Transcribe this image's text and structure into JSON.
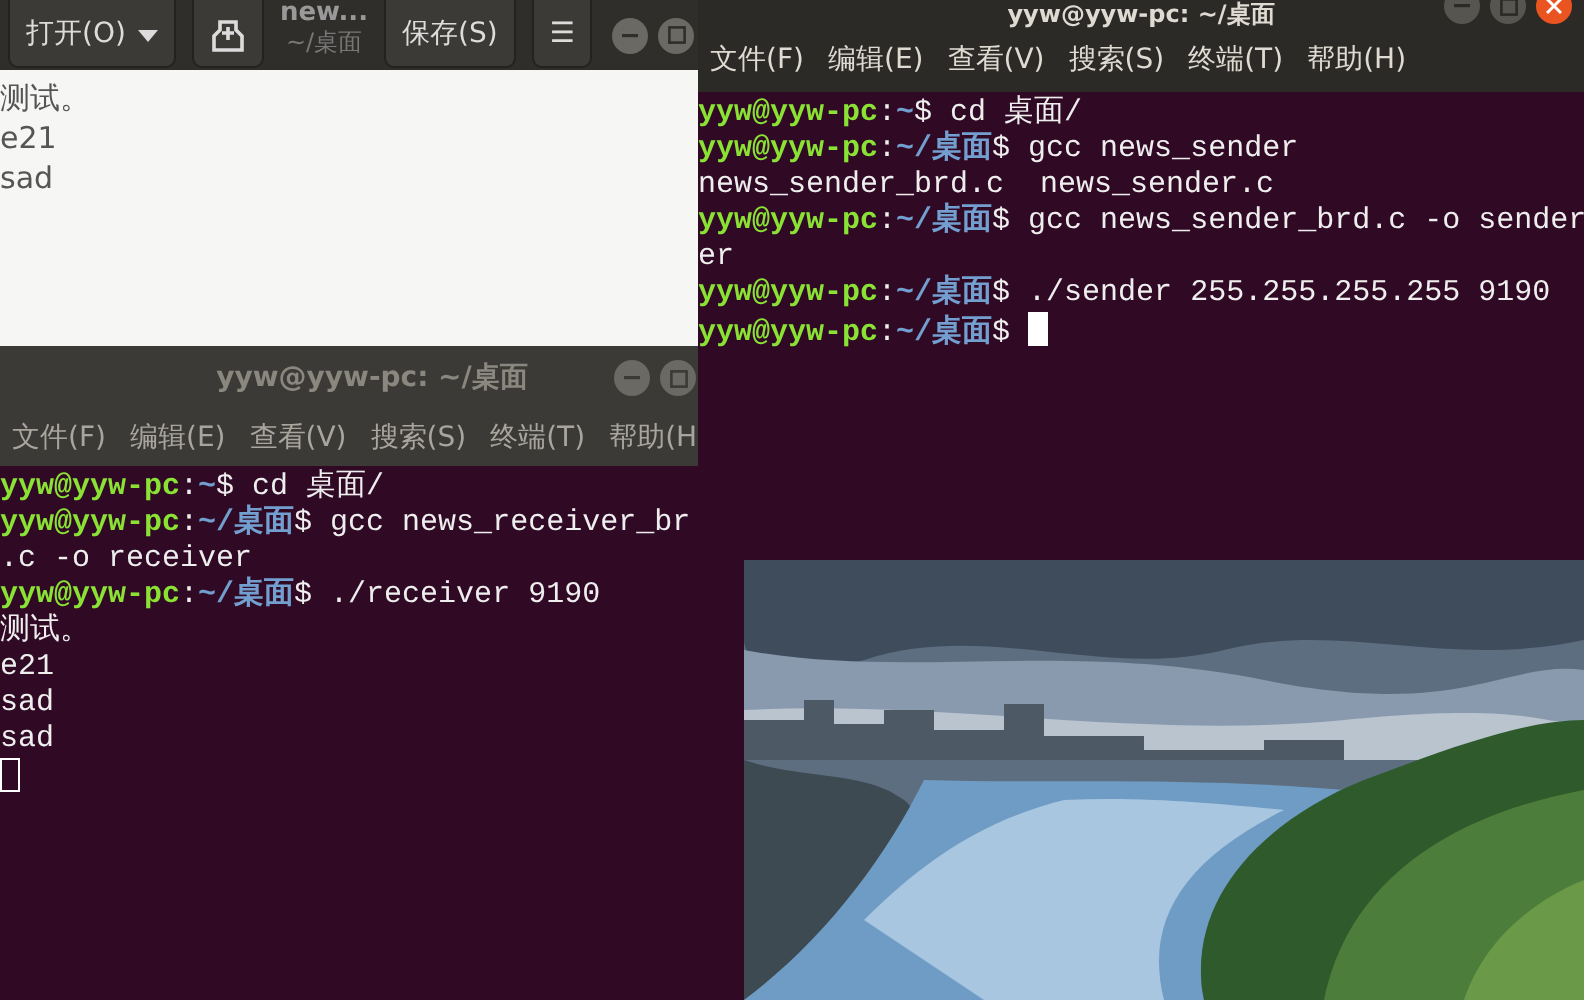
{
  "editor": {
    "open_button": "打开(O)",
    "title": "new...",
    "subtitle": "~/桌面",
    "save_button": "保存(S)",
    "menu_button": "☰",
    "lines": [
      "测试。",
      "e21",
      "sad"
    ]
  },
  "terminals": [
    {
      "title": "yyw@yyw-pc: ~/桌面",
      "focused": false,
      "menu": [
        "文件(F)",
        "编辑(E)",
        "查看(V)",
        "搜索(S)",
        "终端(T)",
        "帮助(H"
      ],
      "lines": [
        [
          {
            "kind": "user",
            "text": "yyw@yyw-pc"
          },
          {
            "kind": "plain",
            "text": ":"
          },
          {
            "kind": "path",
            "text": "~"
          },
          {
            "kind": "plain",
            "text": "$ cd 桌面/"
          }
        ],
        [
          {
            "kind": "user",
            "text": "yyw@yyw-pc"
          },
          {
            "kind": "plain",
            "text": ":"
          },
          {
            "kind": "path",
            "text": "~/桌面"
          },
          {
            "kind": "plain",
            "text": "$ gcc news_receiver_br"
          }
        ],
        [
          {
            "kind": "plain",
            "text": ".c -o receiver"
          }
        ],
        [
          {
            "kind": "user",
            "text": "yyw@yyw-pc"
          },
          {
            "kind": "plain",
            "text": ":"
          },
          {
            "kind": "path",
            "text": "~/桌面"
          },
          {
            "kind": "plain",
            "text": "$ ./receiver 9190"
          }
        ],
        [
          {
            "kind": "plain",
            "text": "测试。"
          }
        ],
        [
          {
            "kind": "plain",
            "text": "e21"
          }
        ],
        [
          {
            "kind": "plain",
            "text": "sad"
          }
        ],
        [
          {
            "kind": "plain",
            "text": "sad"
          }
        ]
      ]
    },
    {
      "title": "yyw@yyw-pc: ~/桌面",
      "focused": true,
      "menu": [
        "文件(F)",
        "编辑(E)",
        "查看(V)",
        "搜索(S)",
        "终端(T)",
        "帮助(H)"
      ],
      "lines": [
        [
          {
            "kind": "user",
            "text": "yyw@yyw-pc"
          },
          {
            "kind": "plain",
            "text": ":"
          },
          {
            "kind": "path",
            "text": "~"
          },
          {
            "kind": "plain",
            "text": "$ cd 桌面/"
          }
        ],
        [
          {
            "kind": "user",
            "text": "yyw@yyw-pc"
          },
          {
            "kind": "plain",
            "text": ":"
          },
          {
            "kind": "path",
            "text": "~/桌面"
          },
          {
            "kind": "plain",
            "text": "$ gcc news_sender"
          }
        ],
        [
          {
            "kind": "plain",
            "text": "news_sender_brd.c  news_sender.c"
          }
        ],
        [
          {
            "kind": "user",
            "text": "yyw@yyw-pc"
          },
          {
            "kind": "plain",
            "text": ":"
          },
          {
            "kind": "path",
            "text": "~/桌面"
          },
          {
            "kind": "plain",
            "text": "$ gcc news_sender_brd.c -o sender"
          }
        ],
        [
          {
            "kind": "plain",
            "text": "er"
          }
        ],
        [
          {
            "kind": "user",
            "text": "yyw@yyw-pc"
          },
          {
            "kind": "plain",
            "text": ":"
          },
          {
            "kind": "path",
            "text": "~/桌面"
          },
          {
            "kind": "plain",
            "text": "$ ./sender 255.255.255.255 9190"
          }
        ],
        [
          {
            "kind": "user",
            "text": "yyw@yyw-pc"
          },
          {
            "kind": "plain",
            "text": ":"
          },
          {
            "kind": "path",
            "text": "~/桌面"
          },
          {
            "kind": "plain",
            "text": "$ "
          }
        ]
      ]
    }
  ]
}
